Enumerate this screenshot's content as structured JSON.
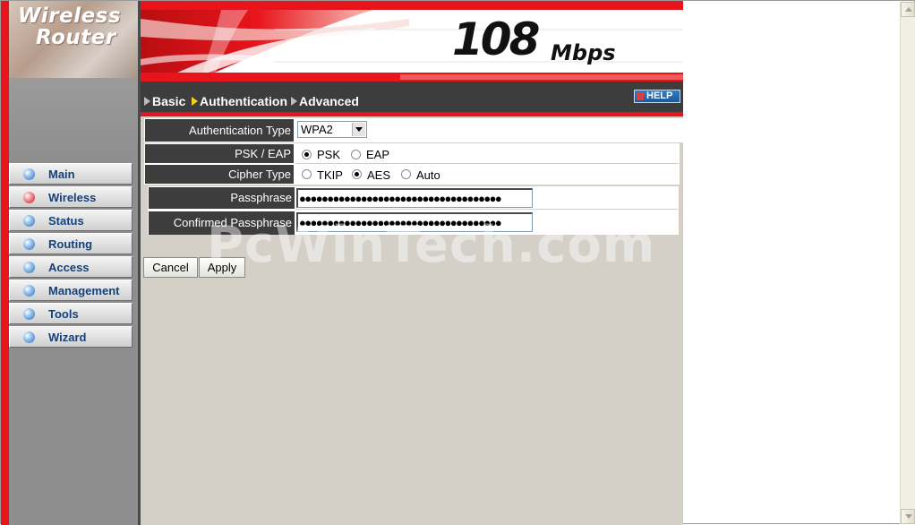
{
  "logo": {
    "line1": "Wireless",
    "line2": "Router"
  },
  "banner": {
    "speed": "108",
    "unit": "Mbps"
  },
  "nav": {
    "items": [
      {
        "label": "Main"
      },
      {
        "label": "Wireless"
      },
      {
        "label": "Status"
      },
      {
        "label": "Routing"
      },
      {
        "label": "Access"
      },
      {
        "label": "Management"
      },
      {
        "label": "Tools"
      },
      {
        "label": "Wizard"
      }
    ],
    "active": "Wireless"
  },
  "tabs": {
    "basic": "Basic",
    "authentication": "Authentication",
    "advanced": "Advanced",
    "active": "Authentication"
  },
  "help": {
    "label": "HELP"
  },
  "form": {
    "auth_type": {
      "label": "Authentication Type",
      "value": "WPA2"
    },
    "psk_eap": {
      "label": "PSK / EAP",
      "options": [
        "PSK",
        "EAP"
      ],
      "selected": "PSK"
    },
    "cipher": {
      "label": "Cipher Type",
      "options": [
        "TKIP",
        "AES",
        "Auto"
      ],
      "selected": "AES"
    },
    "passphrase": {
      "label": "Passphrase",
      "masked": "●●●●●●●●●●●●●●●●●●●●●●●●●●●●●●●●●●●●"
    },
    "confirmed": {
      "label": "Confirmed Passphrase",
      "masked": "●●●●●●●●●●●●●●●●●●●●●●●●●●●●●●●●●●●●"
    }
  },
  "buttons": {
    "cancel": "Cancel",
    "apply": "Apply"
  },
  "watermark": "PcWinTech.com",
  "colors": {
    "accent_red": "#e8141b",
    "dark_bar": "#3d3d3d",
    "nav_text": "#16407a",
    "content_bg": "#d4d0c8"
  }
}
